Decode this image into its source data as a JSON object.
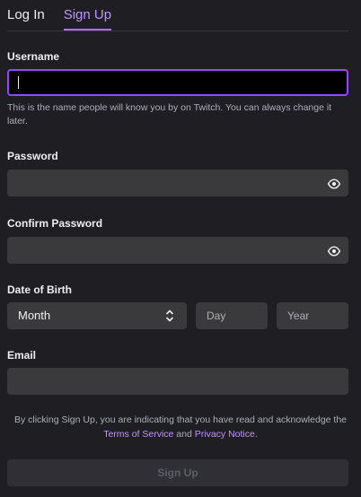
{
  "tabs": [
    {
      "label": "Log In",
      "active": false
    },
    {
      "label": "Sign Up",
      "active": true
    }
  ],
  "username": {
    "label": "Username",
    "value": "",
    "hint": "This is the name people will know you by on Twitch. You can always change it later."
  },
  "password": {
    "label": "Password",
    "value": "",
    "toggle_icon": "eye-icon"
  },
  "confirm_password": {
    "label": "Confirm Password",
    "value": "",
    "toggle_icon": "eye-icon"
  },
  "dob": {
    "label": "Date of Birth",
    "month": "Month",
    "day_placeholder": "Day",
    "year_placeholder": "Year",
    "month_icon": "updown-arrows-icon"
  },
  "email": {
    "label": "Email",
    "value": ""
  },
  "legal": {
    "prefix": "By clicking Sign Up, you are indicating that you have read and acknowledge the ",
    "terms_link": "Terms of Service",
    "middle": " and ",
    "privacy_link": "Privacy Notice",
    "suffix": "."
  },
  "submit": {
    "label": "Sign Up",
    "enabled": false
  },
  "colors": {
    "background": "#1f1f23",
    "input": "#3a3a3d",
    "accent": "#9147ff",
    "accent_text": "#bf94ff",
    "muted_text": "#adadb8"
  }
}
